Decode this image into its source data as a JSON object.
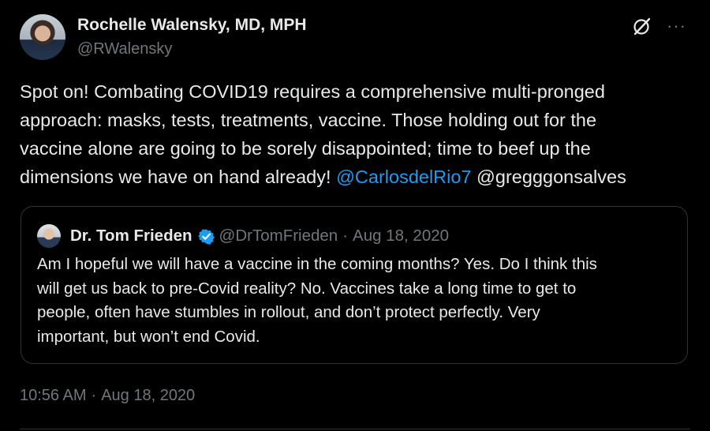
{
  "author": {
    "name": "Rochelle Walensky, MD, MPH",
    "handle": "@RWalensky"
  },
  "tweet": {
    "lines": [
      "Spot on! Combating COVID19 requires a comprehensive multi-pronged",
      "approach: masks, tests, treatments, vaccine. Those holding out for the",
      "vaccine alone are going to be sorely disappointed; time to beef up the",
      "dimensions we have on hand already! "
    ],
    "mention_1": "@CarlosdelRio7",
    "mention_2": " @gregggonsalves"
  },
  "quote": {
    "name": "Dr. Tom Frieden",
    "handle": "@DrTomFrieden",
    "separator": "·",
    "date": "Aug 18, 2020",
    "lines": [
      "Am I hopeful we will have a vaccine in the coming months? Yes. Do I think this",
      "will get us back to pre-Covid reality? No. Vaccines take a long time to get to",
      "people, often have stumbles in rollout, and don’t protect perfectly. Very",
      "important, but won’t end Covid."
    ]
  },
  "meta": {
    "time": "10:56 AM",
    "separator": "·",
    "date": "Aug 18, 2020"
  },
  "icons": {
    "grok": "grok-icon",
    "more": "more-icon",
    "verified": "verified-badge-icon"
  },
  "colors": {
    "background": "#000000",
    "text": "#e7e9ea",
    "secondary": "#71767b",
    "link": "#1d9bf0",
    "border": "#2f3336"
  }
}
